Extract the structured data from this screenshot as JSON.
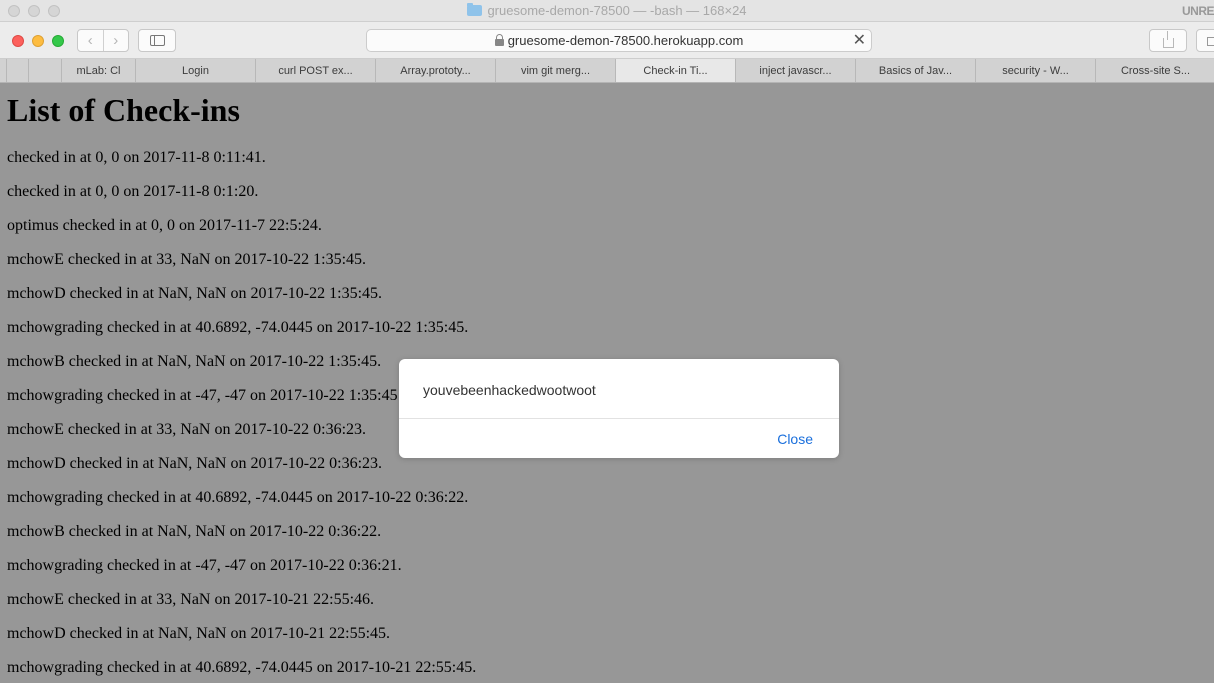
{
  "terminal": {
    "title": "gruesome-demon-78500 — -bash — 168×24",
    "right_text": "UNRE"
  },
  "toolbar": {
    "back_glyph": "‹",
    "forward_glyph": "›",
    "url": "gruesome-demon-78500.herokuapp.com",
    "clear_glyph": "✕"
  },
  "tabs": [
    {
      "label": ""
    },
    {
      "label": "mLab: Cl"
    },
    {
      "label": "Login"
    },
    {
      "label": "curl POST ex..."
    },
    {
      "label": "Array.prototy..."
    },
    {
      "label": "vim git merg..."
    },
    {
      "label": "Check-in Ti..."
    },
    {
      "label": "inject javascr..."
    },
    {
      "label": "Basics of Jav..."
    },
    {
      "label": "security - W..."
    },
    {
      "label": "Cross-site S..."
    }
  ],
  "page": {
    "title": "List of Check-ins",
    "entries": [
      "checked in at 0, 0 on 2017-11-8 0:11:41.",
      "checked in at 0, 0 on 2017-11-8 0:1:20.",
      "optimus checked in at 0, 0 on 2017-11-7 22:5:24.",
      "mchowE checked in at 33, NaN on 2017-10-22 1:35:45.",
      "mchowD checked in at NaN, NaN on 2017-10-22 1:35:45.",
      "mchowgrading checked in at 40.6892, -74.0445 on 2017-10-22 1:35:45.",
      "mchowB checked in at NaN, NaN on 2017-10-22 1:35:45.",
      "mchowgrading checked in at -47, -47 on 2017-10-22 1:35:45",
      "mchowE checked in at 33, NaN on 2017-10-22 0:36:23.",
      "mchowD checked in at NaN, NaN on 2017-10-22 0:36:23.",
      "mchowgrading checked in at 40.6892, -74.0445 on 2017-10-22 0:36:22.",
      "mchowB checked in at NaN, NaN on 2017-10-22 0:36:22.",
      "mchowgrading checked in at -47, -47 on 2017-10-22 0:36:21.",
      "mchowE checked in at 33, NaN on 2017-10-21 22:55:46.",
      "mchowD checked in at NaN, NaN on 2017-10-21 22:55:45.",
      "mchowgrading checked in at 40.6892, -74.0445 on 2017-10-21 22:55:45."
    ]
  },
  "alert": {
    "message": "youvebeenhackedwootwoot",
    "close_label": "Close"
  },
  "colors": {
    "overlay_background": "#979797",
    "link_blue": "#1a6fdc"
  }
}
